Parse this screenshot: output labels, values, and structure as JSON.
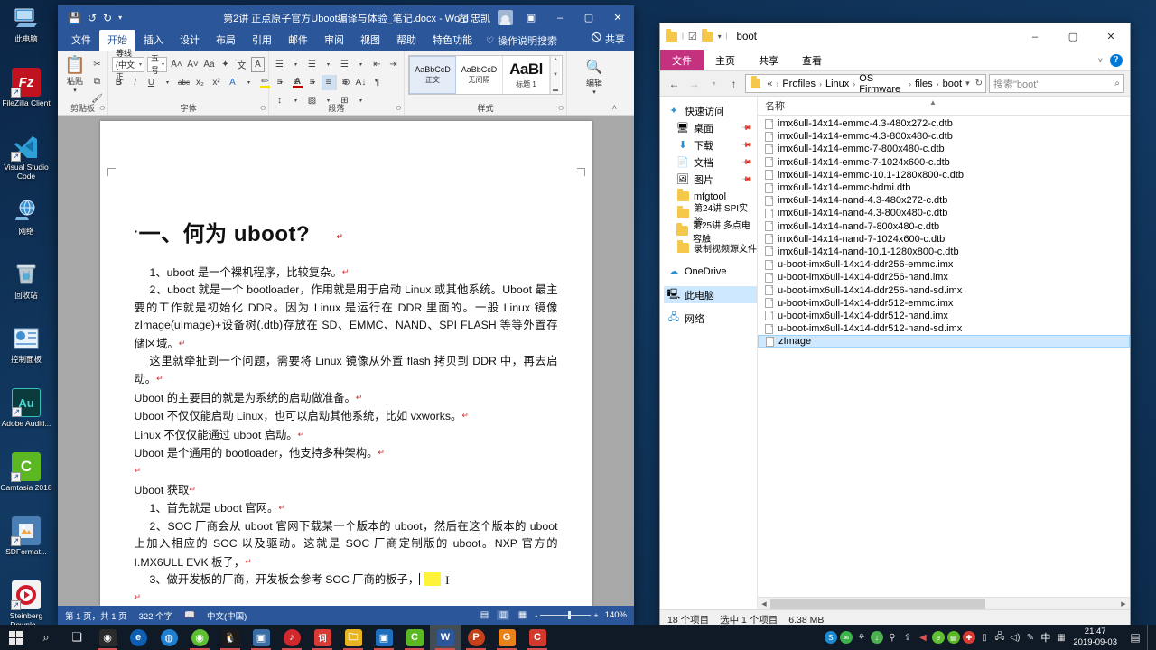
{
  "desktop": {
    "icons": [
      {
        "label": "此电脑",
        "icon": "this-pc-icon",
        "glyph": "🖥",
        "bg": "transparent",
        "shortcut": false
      },
      {
        "label": "FileZilla Client",
        "icon": "filezilla-icon",
        "glyph": "Fz",
        "bg": "#c1121f",
        "shortcut": true
      },
      {
        "label": "Visual Studio Code",
        "icon": "vscode-icon",
        "glyph": "◀",
        "bg": "transparent",
        "shortcut": true
      },
      {
        "label": "网络",
        "icon": "network-icon",
        "glyph": "🌐",
        "bg": "transparent",
        "shortcut": false
      },
      {
        "label": "回收站",
        "icon": "recycle-bin-icon",
        "glyph": "🗑",
        "bg": "transparent",
        "shortcut": false
      },
      {
        "label": "控制面板",
        "icon": "control-panel-icon",
        "glyph": "⚙",
        "bg": "#2f6fb5",
        "shortcut": false
      },
      {
        "label": "Adobe Auditi...",
        "icon": "adobe-audition-icon",
        "glyph": "Au",
        "bg": "#0b3b3c",
        "shortcut": true
      },
      {
        "label": "Camtasia 2018",
        "icon": "camtasia-icon",
        "glyph": "C",
        "bg": "#5bb823",
        "shortcut": true
      },
      {
        "label": "SDFormat...",
        "icon": "sdformatter-icon",
        "glyph": "◩",
        "bg": "#4a7fb5",
        "shortcut": true
      },
      {
        "label": "Steinberg Downlo...",
        "icon": "steinberg-icon",
        "glyph": "▶",
        "bg": "#cf1b2b",
        "shortcut": true
      }
    ]
  },
  "word": {
    "title": "第2讲 正点原子官方Uboot编译与体验_笔记.docx  -  Word",
    "user": "左 忠凯",
    "quick_access": [
      "save-icon",
      "undo-icon",
      "redo-icon",
      "customize-icon"
    ],
    "window_buttons": {
      "ribbon_display": "▣",
      "minimize": "–",
      "maximize": "▢",
      "close": "✕"
    },
    "tabs": [
      "文件",
      "开始",
      "插入",
      "设计",
      "布局",
      "引用",
      "邮件",
      "审阅",
      "视图",
      "帮助",
      "特色功能"
    ],
    "active_tab": "开始",
    "tell_me": "操作说明搜索",
    "share": "共享",
    "ribbon": {
      "clipboard": {
        "label": "剪贴板",
        "paste": "粘贴",
        "cut": "✂",
        "copy": "⧉",
        "format_painter": "🖌"
      },
      "font": {
        "label": "字体",
        "font_name": "等线 (中文正",
        "font_size": "五号",
        "grow": "A",
        "shrink": "A",
        "case": "Aa",
        "clear": "✦",
        "phonetic": "文",
        "border": "A",
        "bold": "B",
        "italic": "I",
        "underline": "U",
        "strike": "abc",
        "subscript": "x₂",
        "superscript": "x²",
        "text_effects": "A",
        "highlight": "✏",
        "font_color": "A",
        "char_shading": "A",
        "char_border": "⊜"
      },
      "paragraph": {
        "label": "段落",
        "bullets": "☰",
        "numbering": "☰",
        "multilevel": "☰",
        "dec_indent": "⇤",
        "inc_indent": "⇥",
        "sort": "A↓",
        "marks": "¶",
        "align_left": "≡",
        "align_center": "≡",
        "align_right": "≡",
        "justify": "≡",
        "distribute": "≡",
        "line_spacing": "↕",
        "shading": "▨",
        "borders": "⊞"
      },
      "styles": {
        "label": "样式",
        "items": [
          {
            "preview": "AaBbCcD",
            "name": "正文",
            "selected": true
          },
          {
            "preview": "AaBbCcD",
            "name": "无间隔",
            "selected": false
          },
          {
            "preview": "AaBl",
            "name": "标题 1",
            "selected": false
          }
        ]
      },
      "editing": {
        "label": "编辑",
        "button": "编辑",
        "glyph": "🔍"
      }
    },
    "document": {
      "heading": "一、何为 uboot?",
      "paragraphs": [
        "1、uboot 是一个裸机程序，比较复杂。",
        "2、uboot 就是一个 bootloader，作用就是用于启动 Linux 或其他系统。Uboot 最主要的工作就是初始化 DDR。因为 Linux 是运行在 DDR 里面的。一般 Linux 镜像 zImage(uImage)+设备树(.dtb)存放在 SD、EMMC、NAND、SPI FLASH 等等外置存储区域。",
        "这里就牵扯到一个问题，需要将 Linux 镜像从外置 flash 拷贝到 DDR 中，再去启动。",
        "Uboot 的主要目的就是为系统的启动做准备。",
        "Uboot 不仅仅能启动 Linux，也可以启动其他系统，比如 vxworks。",
        "Linux 不仅仅能通过 uboot 启动。",
        "Uboot 是个通用的 bootloader，他支持多种架构。",
        "Uboot 获取",
        "1、首先就是 uboot 官网。",
        "2、SOC 厂商会从 uboot 官网下载某一个版本的 uboot，然后在这个版本的 uboot 上加入相应的 SOC 以及驱动。这就是 SOC 厂商定制版的 uboot。NXP 官方的 I.MX6ULL EVK 板子，",
        "3、做开发板的厂商，开发板会参考 SOC 厂商的板子，"
      ]
    },
    "status": {
      "page": "第 1 页，共 1 页",
      "words": "322 个字",
      "proof_icon": "proofing-icon",
      "language": "中文(中国)",
      "views": [
        "read-mode-icon",
        "print-layout-icon",
        "web-layout-icon"
      ],
      "zoom_out": "-",
      "zoom_in": "+",
      "zoom": "140%"
    }
  },
  "explorer": {
    "title": "boot",
    "window_buttons": {
      "minimize": "–",
      "maximize": "▢",
      "close": "✕"
    },
    "tabs": {
      "file": "文件",
      "items": [
        "主页",
        "共享",
        "查看"
      ]
    },
    "address": {
      "back": "←",
      "forward": "→",
      "recent": "▾",
      "up": "↑",
      "root": "«",
      "crumbs": [
        "Profiles",
        "Linux",
        "OS Firmware",
        "files",
        "boot"
      ],
      "dropdown": "▾",
      "refresh": "↻"
    },
    "search": {
      "placeholder": "搜索\"boot\"",
      "icon": "search-icon"
    },
    "nav_pane": [
      {
        "label": "快速访问",
        "icon": "star-icon",
        "pinned": false,
        "indent": false
      },
      {
        "label": "桌面",
        "icon": "desktop-icon",
        "pinned": true,
        "indent": true
      },
      {
        "label": "下载",
        "icon": "downloads-icon",
        "pinned": true,
        "indent": true
      },
      {
        "label": "文档",
        "icon": "documents-icon",
        "pinned": true,
        "indent": true
      },
      {
        "label": "图片",
        "icon": "pictures-icon",
        "pinned": true,
        "indent": true
      },
      {
        "label": "mfgtool",
        "icon": "folder-icon",
        "pinned": false,
        "indent": true
      },
      {
        "label": "第24讲 SPI实验",
        "icon": "folder-icon",
        "pinned": false,
        "indent": true
      },
      {
        "label": "第25讲 多点电容触",
        "icon": "folder-icon",
        "pinned": false,
        "indent": true
      },
      {
        "label": "录制视频源文件",
        "icon": "folder-icon",
        "pinned": false,
        "indent": true
      },
      {
        "label": "OneDrive",
        "icon": "onedrive-icon",
        "pinned": false,
        "indent": false
      },
      {
        "label": "此电脑",
        "icon": "this-pc-icon",
        "pinned": false,
        "indent": false
      },
      {
        "label": "网络",
        "icon": "network-icon",
        "pinned": false,
        "indent": false
      }
    ],
    "selected_nav": "此电脑",
    "column_header": "名称",
    "files": [
      {
        "name": "imx6ull-14x14-emmc-4.3-480x272-c.dtb",
        "selected": false
      },
      {
        "name": "imx6ull-14x14-emmc-4.3-800x480-c.dtb",
        "selected": false
      },
      {
        "name": "imx6ull-14x14-emmc-7-800x480-c.dtb",
        "selected": false
      },
      {
        "name": "imx6ull-14x14-emmc-7-1024x600-c.dtb",
        "selected": false
      },
      {
        "name": "imx6ull-14x14-emmc-10.1-1280x800-c.dtb",
        "selected": false
      },
      {
        "name": "imx6ull-14x14-emmc-hdmi.dtb",
        "selected": false
      },
      {
        "name": "imx6ull-14x14-nand-4.3-480x272-c.dtb",
        "selected": false
      },
      {
        "name": "imx6ull-14x14-nand-4.3-800x480-c.dtb",
        "selected": false
      },
      {
        "name": "imx6ull-14x14-nand-7-800x480-c.dtb",
        "selected": false
      },
      {
        "name": "imx6ull-14x14-nand-7-1024x600-c.dtb",
        "selected": false
      },
      {
        "name": "imx6ull-14x14-nand-10.1-1280x800-c.dtb",
        "selected": false
      },
      {
        "name": "u-boot-imx6ull-14x14-ddr256-emmc.imx",
        "selected": false
      },
      {
        "name": "u-boot-imx6ull-14x14-ddr256-nand.imx",
        "selected": false
      },
      {
        "name": "u-boot-imx6ull-14x14-ddr256-nand-sd.imx",
        "selected": false
      },
      {
        "name": "u-boot-imx6ull-14x14-ddr512-emmc.imx",
        "selected": false
      },
      {
        "name": "u-boot-imx6ull-14x14-ddr512-nand.imx",
        "selected": false
      },
      {
        "name": "u-boot-imx6ull-14x14-ddr512-nand-sd.imx",
        "selected": false
      },
      {
        "name": "zImage",
        "selected": true
      }
    ],
    "status": {
      "count": "18 个项目",
      "selection": "选中 1 个项目",
      "size": "6.38 MB"
    }
  },
  "taskbar": {
    "start": "start-icon",
    "search": "search-icon",
    "task_view": "task-view-icon",
    "apps": [
      {
        "name": "camera-icon",
        "glyph": "◉",
        "bg": "#2b2b2b",
        "open": false,
        "active": false
      },
      {
        "name": "edge-icon",
        "glyph": "e",
        "bg": "#0c5fb3",
        "open": false,
        "active": false
      },
      {
        "name": "browser-icon",
        "glyph": "◍",
        "bg": "#1f7fd1",
        "open": false,
        "active": false
      },
      {
        "name": "360-browser-icon",
        "glyph": "◉",
        "bg": "#5fbf32",
        "open": true,
        "active": false
      },
      {
        "name": "tim-icon",
        "glyph": "🐧",
        "bg": "#1b1b1b",
        "open": true,
        "active": false
      },
      {
        "name": "media-player-icon",
        "glyph": "▣",
        "bg": "#3a6ea5",
        "open": true,
        "active": false
      },
      {
        "name": "netease-music-icon",
        "glyph": "♪",
        "bg": "#d0282c",
        "open": true,
        "active": false
      },
      {
        "name": "youdao-icon",
        "glyph": "词",
        "bg": "#d83a34",
        "open": true,
        "active": false
      },
      {
        "name": "file-explorer-icon",
        "glyph": "🗀",
        "bg": "#e8b422",
        "open": true,
        "active": false
      },
      {
        "name": "vmware-icon",
        "glyph": "▣",
        "bg": "#1f6fbf",
        "open": true,
        "active": false
      },
      {
        "name": "camtasia-icon",
        "glyph": "C",
        "bg": "#5bb823",
        "open": true,
        "active": false
      },
      {
        "name": "word-icon",
        "glyph": "W",
        "bg": "#2b579a",
        "open": true,
        "active": true
      },
      {
        "name": "powerpoint-icon",
        "glyph": "P",
        "bg": "#c4421a",
        "open": true,
        "active": false
      },
      {
        "name": "wps-icon",
        "glyph": "G",
        "bg": "#e8821a",
        "open": true,
        "active": false
      },
      {
        "name": "camtasia-editor-icon",
        "glyph": "C",
        "bg": "#d0392b",
        "open": true,
        "active": false
      }
    ],
    "tray": [
      {
        "name": "skype-icon",
        "glyph": "S",
        "bg": "#1c8ad1"
      },
      {
        "name": "wechat-icon",
        "glyph": "✉",
        "bg": "#3bb34a"
      },
      {
        "name": "antivirus-icon",
        "glyph": "⚘",
        "bg": "#2b2b2b"
      },
      {
        "name": "download-icon",
        "glyph": "↓",
        "bg": "#4caf50"
      },
      {
        "name": "usb-icon",
        "glyph": "⚲",
        "bg": "#2b2b2b"
      },
      {
        "name": "cloud-sync-icon",
        "glyph": "⇪",
        "bg": "#2b2b2b"
      },
      {
        "name": "volume-mute-icon",
        "glyph": "◀",
        "bg": "#d83a34"
      },
      {
        "name": "browser-tray-icon",
        "glyph": "e",
        "bg": "#5fbf32"
      },
      {
        "name": "notes-icon",
        "glyph": "▤",
        "bg": "#5bb823"
      },
      {
        "name": "security-icon",
        "glyph": "✚",
        "bg": "#d83a34"
      },
      {
        "name": "battery-icon",
        "glyph": "▯",
        "bg": "#2b2b2b"
      },
      {
        "name": "network-tray-icon",
        "glyph": "🖧",
        "bg": "#2b2b2b"
      },
      {
        "name": "speaker-icon",
        "glyph": "◁)",
        "bg": "#2b2b2b"
      },
      {
        "name": "ime-pen-icon",
        "glyph": "✎",
        "bg": "#2b2b2b"
      },
      {
        "name": "ime-mode-icon",
        "glyph": "中",
        "bg": "#2b2b2b"
      },
      {
        "name": "ime-keyboard-icon",
        "glyph": "⌨",
        "bg": "#2b2b2b"
      }
    ],
    "clock": {
      "time": "21:47",
      "date": "2019-09-03"
    },
    "notifications": "notification-icon"
  }
}
